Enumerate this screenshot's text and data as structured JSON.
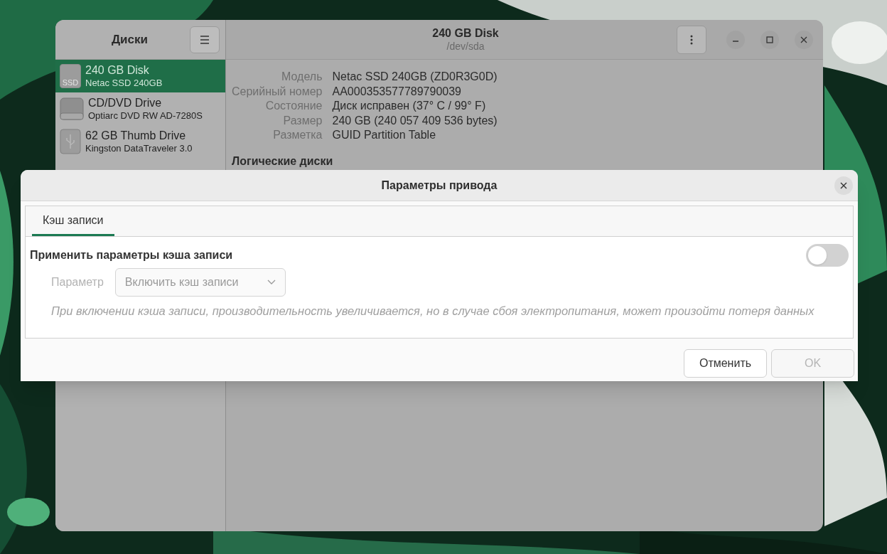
{
  "disks_window": {
    "sidebar_title": "Диски",
    "title": "240 GB Disk",
    "subtitle": "/dev/sda",
    "drives": [
      {
        "kind": "ssd",
        "badge": "SSD",
        "name": "240 GB Disk",
        "model": "Netac SSD 240GB",
        "selected": true
      },
      {
        "kind": "optical",
        "name": "CD/DVD Drive",
        "model": "Optiarc DVD RW AD-7280S",
        "selected": false
      },
      {
        "kind": "usb",
        "name": "62 GB Thumb Drive",
        "model": "Kingston DataTraveler 3.0",
        "selected": false
      }
    ],
    "details": [
      {
        "label": "Модель",
        "value": "Netac SSD 240GB (ZD0R3G0D)"
      },
      {
        "label": "Серийный номер",
        "value": "AA000353577789790039"
      },
      {
        "label": "Состояние",
        "value": "Диск исправен (37° C / 99° F)"
      },
      {
        "label": "Размер",
        "value": "240 GB (240 057 409 536 bytes)"
      },
      {
        "label": "Разметка",
        "value": "GUID Partition Table"
      }
    ],
    "section_heading": "Логические диски"
  },
  "dialog": {
    "title": "Параметры привода",
    "tabs": [
      {
        "label": "Кэш записи",
        "selected": true
      }
    ],
    "switch_label": "Применить параметры кэша записи",
    "switch_on": false,
    "parameter_label": "Параметр",
    "parameter_value": "Включить кэш записи",
    "parameter_disabled": true,
    "hint": "При включении кэша записи, производительность увеличивается, но в случае сбоя электропитания, может произойти потеря данных",
    "buttons": [
      {
        "label": "Отменить",
        "disabled": false
      },
      {
        "label": "OK",
        "disabled": true
      }
    ]
  }
}
